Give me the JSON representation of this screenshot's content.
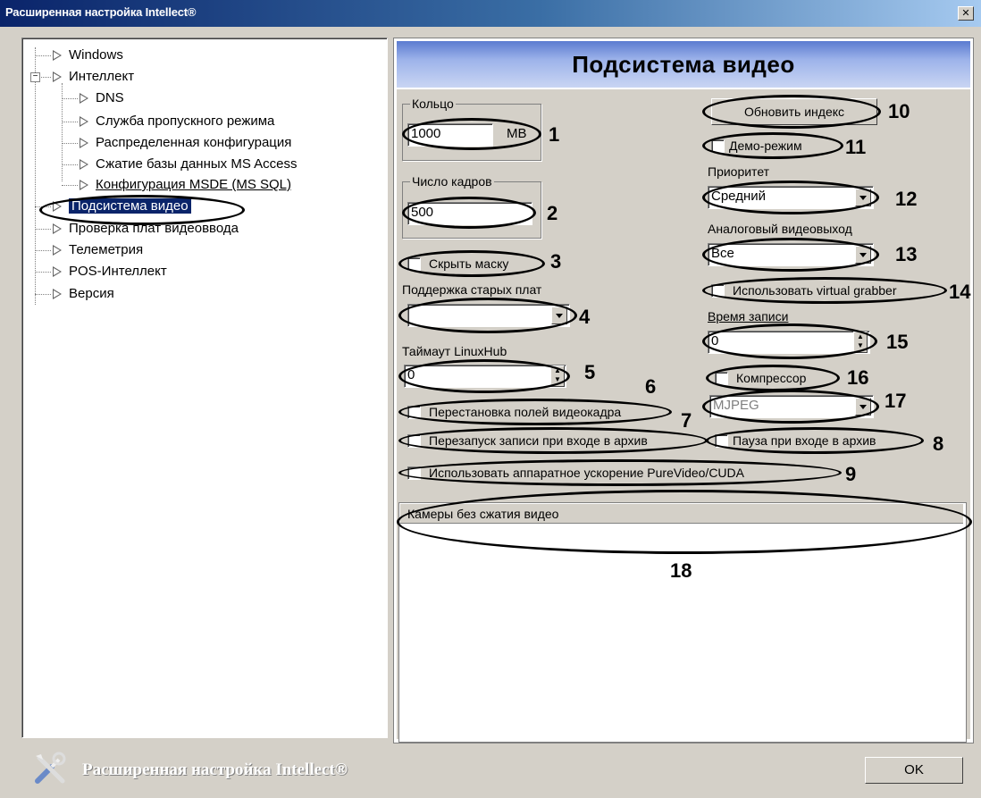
{
  "window": {
    "title": "Расширенная настройка Intellect®",
    "close_glyph": "✕"
  },
  "tree": {
    "items": [
      {
        "label": "Windows"
      },
      {
        "label": "Интеллект",
        "expand": "−"
      },
      {
        "label": "DNS"
      },
      {
        "label": "Служба пропускного режима"
      },
      {
        "label": "Распределенная конфигурация"
      },
      {
        "label": "Сжатие базы данных MS Access"
      },
      {
        "label": "Конфигурация MSDE (MS SQL)"
      },
      {
        "label": "Подсистема видео"
      },
      {
        "label": "Проверка плат видеоввода"
      },
      {
        "label": "Телеметрия"
      },
      {
        "label": "POS-Интеллект"
      },
      {
        "label": "Версия"
      }
    ]
  },
  "panel": {
    "header": "Подсистема видео",
    "ring": {
      "label": "Кольцо",
      "value": "1000",
      "unit": "MB"
    },
    "frames": {
      "label": "Число кадров",
      "value": "500"
    },
    "hide_mask": "Скрыть маску",
    "old_boards": {
      "label": "Поддержка старых плат",
      "value": ""
    },
    "linuxhub": {
      "label": "Таймаут LinuxHub",
      "value": "0"
    },
    "swap_fields": "Перестановка полей видеокадра",
    "restart_record": "Перезапуск записи при входе в архив",
    "pause_archive": "Пауза при входе в архив",
    "hw_accel": "Использовать аппаратное ускорение PureVideo/CUDA",
    "update_index": "Обновить индекс",
    "demo_mode": "Демо-режим",
    "priority": {
      "label": "Приоритет",
      "value": "Средний"
    },
    "analog_out": {
      "label": "Аналоговый видеовыход",
      "value": "Все"
    },
    "virtual_grabber": "Использовать virtual grabber",
    "record_time": {
      "label": "Время записи",
      "value": "0"
    },
    "compressor": "Компрессор",
    "codec": "MJPEG",
    "cameras_header": "Камеры без сжатия видео"
  },
  "callouts": [
    "1",
    "2",
    "3",
    "4",
    "5",
    "6",
    "7",
    "8",
    "9",
    "10",
    "11",
    "12",
    "13",
    "14",
    "15",
    "16",
    "17",
    "18"
  ],
  "footer": {
    "title": "Расширенная настройка Intellect®",
    "ok": "OK"
  }
}
